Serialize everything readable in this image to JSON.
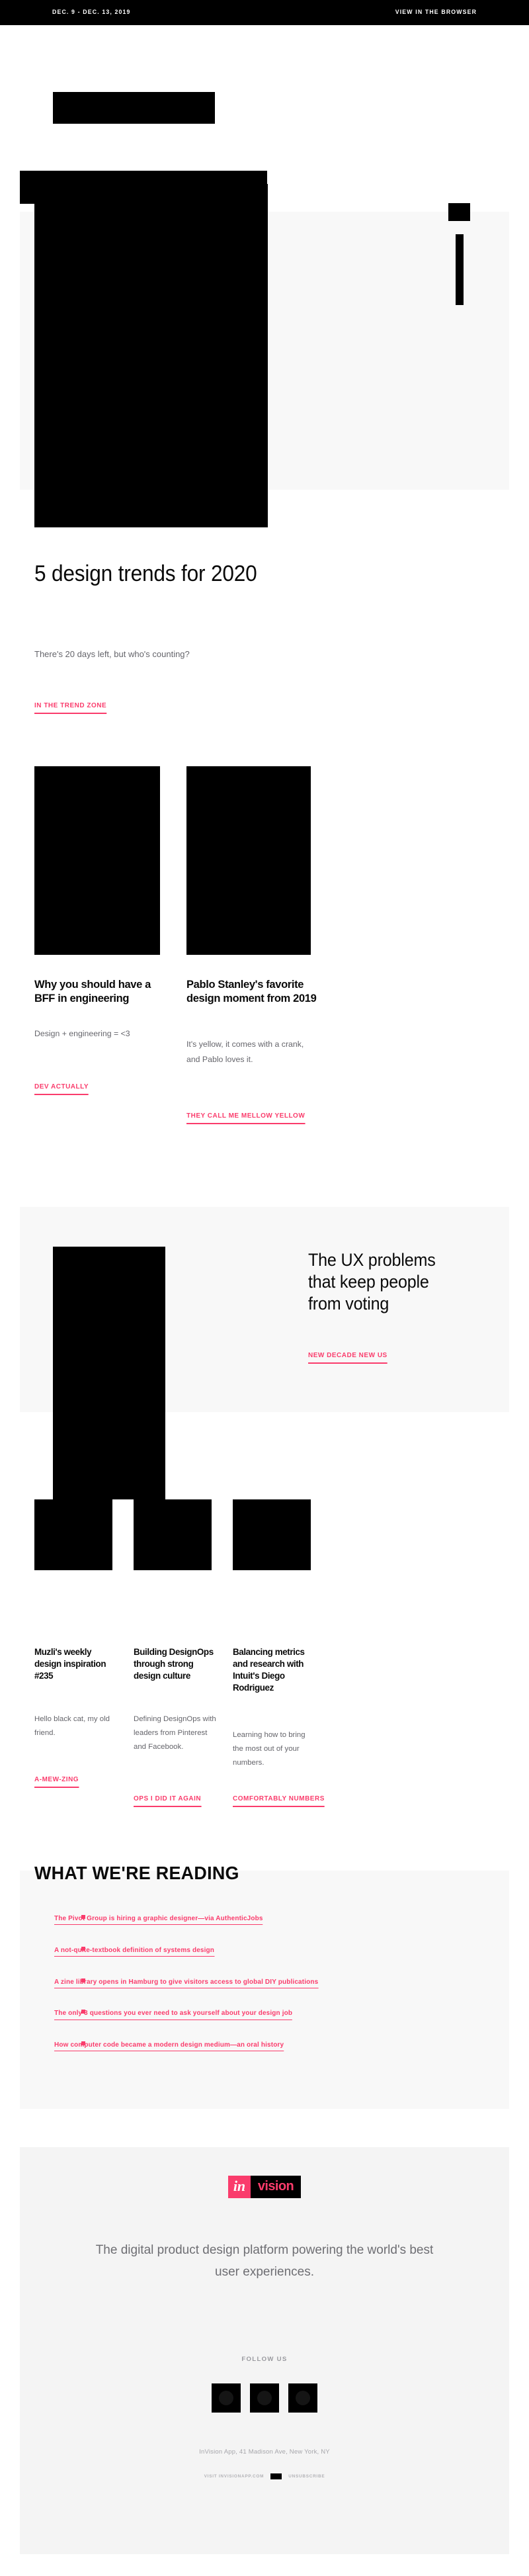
{
  "topbar": {
    "date": "DEC. 9 - DEC. 13, 2019",
    "browser_link": "VIEW IN THE BROWSER"
  },
  "hero": {
    "title": "5 design trends for 2020",
    "subtitle": "There's 20 days left, but who's counting?",
    "cta": "IN THE TREND ZONE"
  },
  "cards": [
    {
      "title": "Why you should have a BFF in engineering",
      "body": "Design + engineering = <3",
      "cta": "DEV ACTUALLY"
    },
    {
      "title": "Pablo Stanley's favorite design moment from 2019",
      "body": "It's yellow, it comes with a crank, and Pablo loves it.",
      "cta": "THEY CALL ME MELLOW YELLOW"
    }
  ],
  "feature": {
    "title": "The UX problems that keep people from voting",
    "cta": "NEW DECADE NEW US"
  },
  "columns": [
    {
      "title": "Muzli's weekly design inspiration #235",
      "body": "Hello black cat, my old friend.",
      "cta": "A-MEW-ZING"
    },
    {
      "title": "Building DesignOps through strong design culture",
      "body": "Defining DesignOps with leaders from Pinterest and Facebook.",
      "cta": "OPS I DID IT AGAIN"
    },
    {
      "title": "Balancing metrics and research with Intuit's Diego Rodriguez",
      "body": "Learning how to bring the most out of your numbers.",
      "cta": "COMFORTABLY NUMBERS"
    }
  ],
  "reading": {
    "heading": "WHAT WE'RE READING",
    "items": [
      "The Pivot Group is hiring a graphic designer—via AuthenticJobs",
      "A not-quite-textbook definition of systems design",
      "A zine library opens in Hamburg to give visitors access to global DIY publications",
      "The only 3 questions you ever need to ask yourself about your design job",
      "How computer code became a modern design medium—an oral history"
    ]
  },
  "footer": {
    "logo_in": "in",
    "logo_vision": "vision",
    "tagline": "The digital product design platform powering the world's best user experiences.",
    "follow_label": "FOLLOW US",
    "address": "InVision App, 41 Madison Ave, New York, NY",
    "link_left": "VISIT INVISIONAPP.COM",
    "link_right": "UNSUBSCRIBE"
  },
  "colors": {
    "accent_pink": "#fa3c6c",
    "black": "#000000",
    "panel_gray": "#f8f8f8",
    "footer_gray": "#f4f4f4",
    "body_text": "#65656b"
  }
}
